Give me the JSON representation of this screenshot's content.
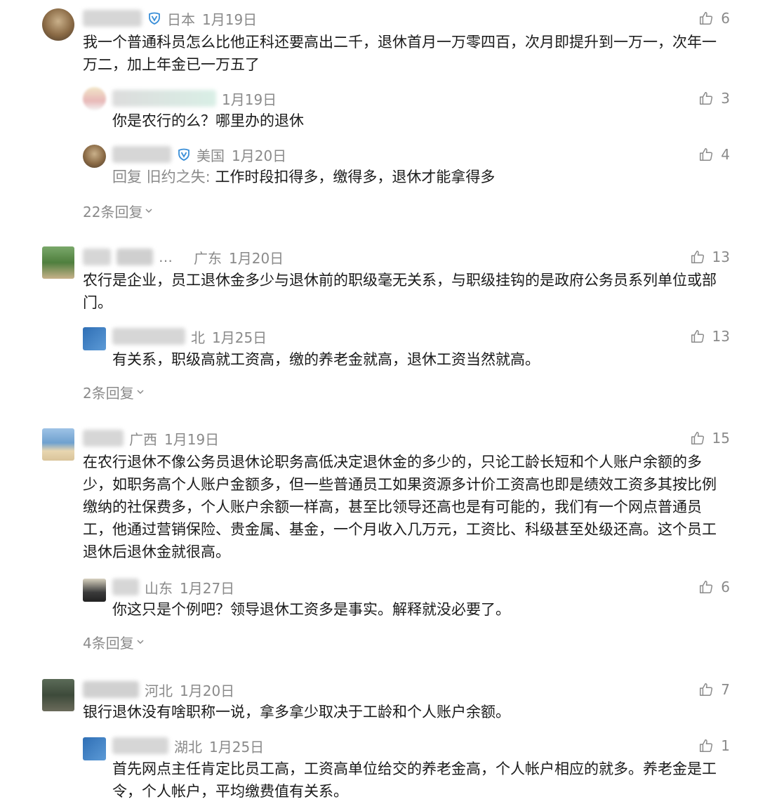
{
  "colors": {
    "meta": "#8a8a8a",
    "text": "#1a1a1a",
    "verified": "#3a8fd8"
  },
  "icons": {
    "like": "thumbs-up-icon",
    "verified": "verified-badge-icon",
    "more": "chevron-down-icon"
  },
  "threads": [
    {
      "comment": {
        "location": "日本",
        "date": "1月19日",
        "likes": "6",
        "text": "我一个普通科员怎么比他正科还要高出二千，退休首月一万零四百，次月即提升到一万一，次年一万二，加上年金已一万五了"
      },
      "replies": [
        {
          "location": "",
          "date": "1月19日",
          "likes": "3",
          "prefix": "",
          "text": "你是农行的么？哪里办的退休"
        },
        {
          "location": "美国",
          "date": "1月20日",
          "likes": "4",
          "prefix": "回复 旧约之失:",
          "text": "工作时段扣得多，缴得多，退休才能拿得多"
        }
      ],
      "more": "22条回复"
    },
    {
      "comment": {
        "location": "广东",
        "date": "1月20日",
        "likes": "13",
        "text": "农行是企业，员工退休金多少与退休前的职级毫无关系，与职级挂钩的是政府公务员系列单位或部门。"
      },
      "replies": [
        {
          "location": "北",
          "date": "1月25日",
          "likes": "13",
          "prefix": "",
          "text": "有关系，职级高就工资高，缴的养老金就高，退休工资当然就高。"
        }
      ],
      "more": "2条回复"
    },
    {
      "comment": {
        "location": "广西",
        "date": "1月19日",
        "likes": "15",
        "text": "在农行退休不像公务员退休论职务高低决定退休金的多少的，只论工龄长短和个人账户余额的多少，如职务高个人账户金额多，但一些普通员工如果资源多计价工资高也即是绩效工资多其按比例缴纳的社保费多，个人账户余额一样高，甚至比领导还高也是有可能的，我们有一个网点普通员工，他通过营销保险、贵金属、基金，一个月收入几万元，工资比、科级甚至处级还高。这个员工退休后退休金就很高。"
      },
      "replies": [
        {
          "location": "山东",
          "date": "1月27日",
          "likes": "6",
          "prefix": "",
          "text": "你这只是个例吧？领导退休工资多是事实。解释就没必要了。"
        }
      ],
      "more": "4条回复"
    },
    {
      "comment": {
        "location": "河北",
        "date": "1月20日",
        "likes": "7",
        "text": "银行退休没有啥职称一说，拿多拿少取决于工龄和个人账户余额。"
      },
      "replies": [
        {
          "location": "湖北",
          "date": "1月25日",
          "likes": "1",
          "prefix": "",
          "text": "首先网点主任肯定比员工高，工资高单位给交的养老金高，个人帐户相应的就多。养老金是工令，个人帐户，平均缴费值有关系。"
        }
      ],
      "more": ""
    }
  ]
}
